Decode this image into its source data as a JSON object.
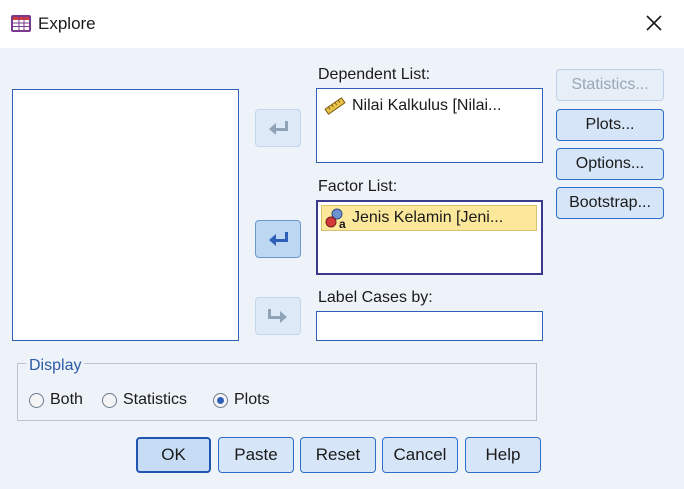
{
  "window": {
    "title": "Explore",
    "app_icon": "spss-table-icon"
  },
  "variable_source": {
    "items": []
  },
  "dependent": {
    "label": "Dependent List:",
    "items": [
      {
        "icon": "ruler-scale-icon",
        "text": "Nilai Kalkulus [Nilai..."
      }
    ]
  },
  "factor": {
    "label": "Factor List:",
    "items": [
      {
        "icon": "nominal-variable-icon",
        "text": "Jenis Kelamin [Jeni..."
      }
    ]
  },
  "label_cases": {
    "label": "Label Cases by:",
    "value": ""
  },
  "side_buttons": {
    "statistics": "Statistics...",
    "plots": "Plots...",
    "options": "Options...",
    "bootstrap": "Bootstrap..."
  },
  "display": {
    "legend": "Display",
    "options": [
      "Both",
      "Statistics",
      "Plots"
    ],
    "selected": "Plots"
  },
  "buttons": {
    "ok": "OK",
    "paste": "Paste",
    "reset": "Reset",
    "cancel": "Cancel",
    "help": "Help"
  },
  "colors": {
    "accent": "#2e60b8",
    "client_bg": "#eef3fa",
    "selection": "#fce89a"
  }
}
